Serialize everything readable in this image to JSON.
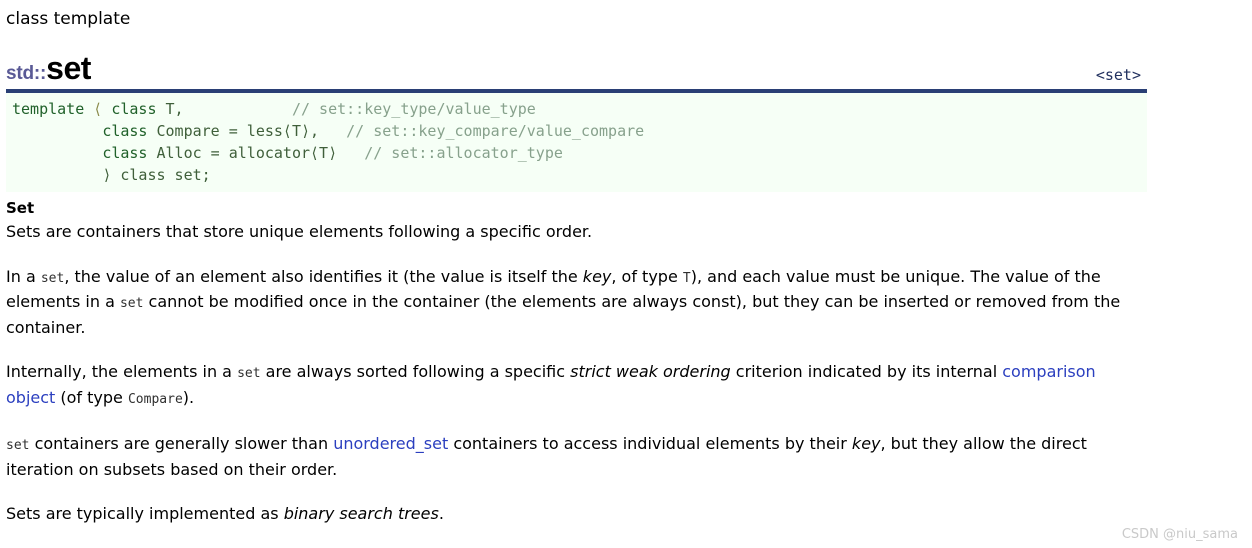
{
  "header": {
    "kicker": "class template",
    "namespace": "std::",
    "name": "set",
    "include_link": "<set>"
  },
  "code": {
    "line1_kw": "template",
    "line1_lt": " ⟨ ",
    "line1_kw2": "class",
    "line1_rest": " T,",
    "line1_comment": "// set::key_type/value_type",
    "line2_kw": "class",
    "line2_rest": " Compare = less⟨T⟩,",
    "line2_comment": "// set::key_compare/value_compare",
    "line3_kw": "class",
    "line3_rest": " Alloc = allocator⟨T⟩",
    "line3_comment": "// set::allocator_type",
    "line4": "⟩ class set;"
  },
  "content": {
    "section_title": "Set",
    "p1": "Sets are containers that store unique elements following a specific order.",
    "p2": {
      "a": "In a ",
      "code1": "set",
      "b": ", the value of an element also identifies it (the value is itself the ",
      "em1": "key",
      "c": ", of type ",
      "code2": "T",
      "d": "), and each value must be unique. The value of the elements in a ",
      "code3": "set",
      "e": " cannot be modified once in the container (the elements are always const), but they can be inserted or removed from the container."
    },
    "p3": {
      "a": "Internally, the elements in a ",
      "code1": "set",
      "b": " are always sorted following a specific ",
      "em1": "strict weak ordering",
      "c": " criterion indicated by its internal ",
      "link1": "comparison object",
      "d": " (of type ",
      "code2": "Compare",
      "e": ")."
    },
    "p4": {
      "code1": "set",
      "a": " containers are generally slower than ",
      "link1": "unordered_set",
      "b": " containers to access individual elements by their ",
      "em1": "key",
      "c": ", but they allow the direct iteration on subsets based on their order."
    },
    "p5": {
      "a": "Sets are typically implemented as ",
      "em1": "binary search trees",
      "b": "."
    }
  },
  "watermark": "CSDN @niu_sama",
  "colors": {
    "rule": "#2a3f75",
    "namespace": "#5a5a96",
    "code_bg": "#f6fff6",
    "code_text": "#2f6b34",
    "code_comment": "#87a18c",
    "link": "#2b3fbf",
    "header_link": "#22315f",
    "watermark": "#c9c9c9"
  }
}
